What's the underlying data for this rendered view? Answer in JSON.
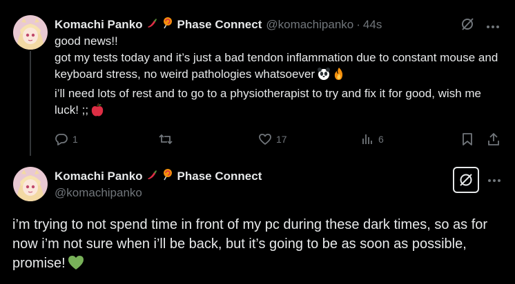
{
  "tweet1": {
    "display_name": "Komachi Panko",
    "name_emojis": [
      "chili-pepper",
      "lollipop"
    ],
    "affiliation": "Phase Connect",
    "handle": "@komachipanko",
    "separator": "·",
    "time": "44s",
    "lines": [
      "good news!!",
      "got my tests today and it’s just a bad tendon inflammation due to constant mouse and keyboard stress, no weird pathologies whatsoever",
      "i’ll need lots of rest and to go to a physiotherapist to try and fix it for good, wish me luck! ;;"
    ],
    "line_emojis": [
      "panda-face",
      "fire",
      "red-apple"
    ],
    "actions": {
      "replies": "1",
      "reposts": "",
      "likes": "17",
      "views": "6"
    }
  },
  "tweet2": {
    "display_name": "Komachi Panko",
    "name_emojis": [
      "chili-pepper",
      "lollipop"
    ],
    "affiliation": "Phase Connect",
    "handle": "@komachipanko",
    "text": "i’m trying to not spend time in front of my pc during these dark times, so as for now i’m not sure when i’ll be back, but it’s going to be as soon as possible, promise!",
    "text_emoji": "green-heart"
  },
  "colors": {
    "background": "#000000",
    "text": "#e7e9ea",
    "secondary": "#71767b",
    "line": "#333639",
    "green_heart": "#78b159",
    "apple": "#dd2e44"
  },
  "icons": [
    "reply-icon",
    "repost-icon",
    "like-icon",
    "views-icon",
    "bookmark-icon",
    "share-icon",
    "grok-icon",
    "more-icon"
  ]
}
